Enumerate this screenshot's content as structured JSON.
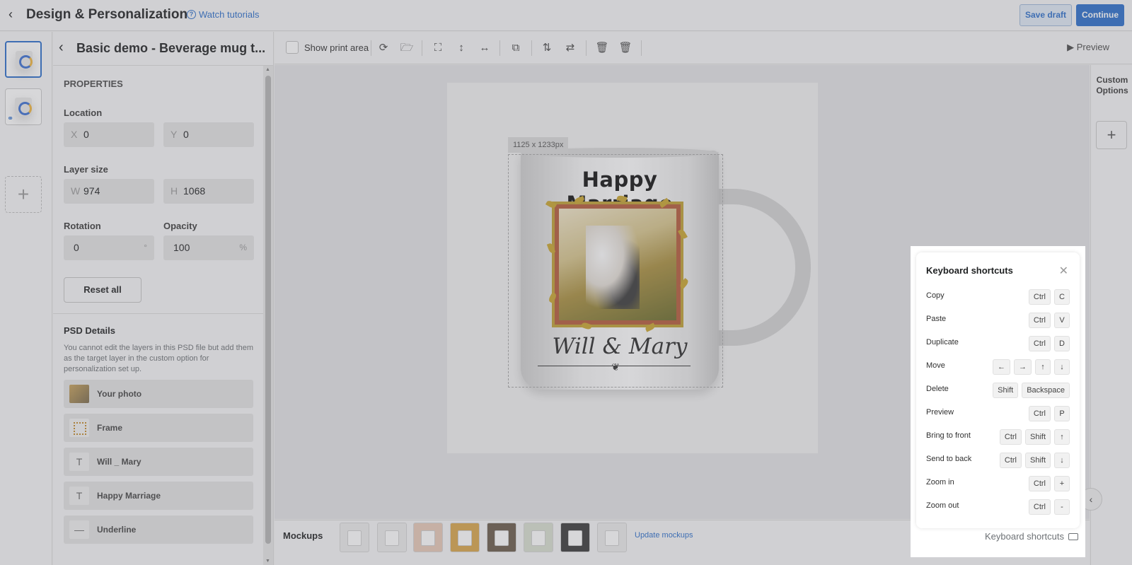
{
  "header": {
    "title": "Design & Personalization",
    "watch_tutorials": "Watch tutorials",
    "save_draft": "Save draft",
    "continue": "Continue"
  },
  "panel": {
    "product_name": "Basic demo - Beverage mug t...",
    "properties_heading": "PROPERTIES",
    "location_label": "Location",
    "x_prefix": "X",
    "x_value": "0",
    "y_prefix": "Y",
    "y_value": "0",
    "layer_size_label": "Layer size",
    "w_prefix": "W",
    "w_value": "974",
    "h_prefix": "H",
    "h_value": "1068",
    "rotation_label": "Rotation",
    "rotation_value": "0",
    "rotation_unit": "°",
    "opacity_label": "Opacity",
    "opacity_value": "100",
    "opacity_unit": "%",
    "reset_all": "Reset all",
    "psd_title": "PSD Details",
    "psd_note": "You cannot edit the layers in this PSD file but add them as the target layer in the custom option for personalization set up.",
    "layers": [
      {
        "name": "Your photo",
        "icon": "photo-icon"
      },
      {
        "name": "Frame",
        "icon": "frame-icon"
      },
      {
        "name": "Will _ Mary",
        "icon": "text-icon"
      },
      {
        "name": "Happy Marriage",
        "icon": "text-icon"
      },
      {
        "name": "Underline",
        "icon": "line-icon"
      }
    ]
  },
  "toolbar": {
    "show_print_area": "Show print area",
    "preview": "Preview"
  },
  "canvas": {
    "dims": "1125 x 1233px",
    "happy_text": "Happy Marriage",
    "will_text": "Will & Mary"
  },
  "bottom": {
    "mockups_label": "Mockups",
    "update_mockups": "Update mockups"
  },
  "rightbar": {
    "custom_options": "Custom Options"
  },
  "shortcuts": {
    "title": "Keyboard shortcuts",
    "footer": "Keyboard shortcuts",
    "items": [
      {
        "name": "Copy",
        "keys": [
          "Ctrl",
          "C"
        ]
      },
      {
        "name": "Paste",
        "keys": [
          "Ctrl",
          "V"
        ]
      },
      {
        "name": "Duplicate",
        "keys": [
          "Ctrl",
          "D"
        ]
      },
      {
        "name": "Move",
        "keys": [
          "←",
          "→",
          "↑",
          "↓"
        ]
      },
      {
        "name": "Delete",
        "keys": [
          "Shift",
          "Backspace"
        ]
      },
      {
        "name": "Preview",
        "keys": [
          "Ctrl",
          "P"
        ]
      },
      {
        "name": "Bring to front",
        "keys": [
          "Ctrl",
          "Shift",
          "↑"
        ]
      },
      {
        "name": "Send to back",
        "keys": [
          "Ctrl",
          "Shift",
          "↓"
        ]
      },
      {
        "name": "Zoom in",
        "keys": [
          "Ctrl",
          "+"
        ]
      },
      {
        "name": "Zoom out",
        "keys": [
          "Ctrl",
          "-"
        ]
      }
    ]
  }
}
